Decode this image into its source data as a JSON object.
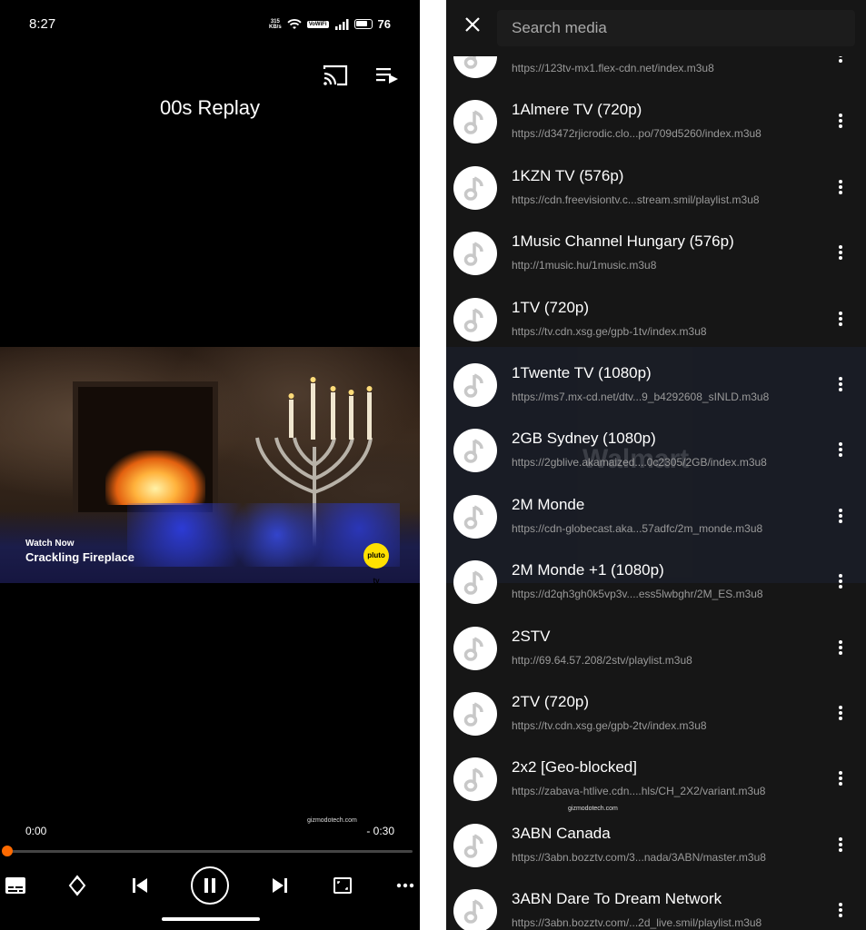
{
  "status_bar": {
    "time": "8:27",
    "net_speed_top": "315",
    "net_speed_bottom": "KB/s",
    "volte": "VoWiFi",
    "battery": "76"
  },
  "player": {
    "title": "00s Replay",
    "video_overlay": {
      "watch_now": "Watch Now",
      "program": "Crackling Fireplace",
      "brand": "pluto tv"
    },
    "watermark": "gizmodotech.com",
    "time_elapsed": "0:00",
    "time_remaining": "- 0:30",
    "progress": 0.0,
    "accent_color": "#ff6a00"
  },
  "media_list": {
    "search_placeholder": "Search media",
    "watermark": "gizmodotech.com",
    "background_ghost_text": "Walmart",
    "items": [
      {
        "name": "",
        "url": "https://123tv-mx1.flex-cdn.net/index.m3u8"
      },
      {
        "name": "1Almere TV (720p)",
        "url": "https://d3472rjicrodic.clo...po/709d5260/index.m3u8"
      },
      {
        "name": "1KZN TV (576p)",
        "url": "https://cdn.freevisiontv.c...stream.smil/playlist.m3u8"
      },
      {
        "name": "1Music Channel Hungary (576p)",
        "url": "http://1music.hu/1music.m3u8"
      },
      {
        "name": "1TV (720p)",
        "url": "https://tv.cdn.xsg.ge/gpb-1tv/index.m3u8"
      },
      {
        "name": "1Twente TV (1080p)",
        "url": "https://ms7.mx-cd.net/dtv...9_b4292608_sINLD.m3u8"
      },
      {
        "name": "2GB Sydney (1080p)",
        "url": "https://2gblive.akamaized....0c2305/2GB/index.m3u8"
      },
      {
        "name": "2M Monde",
        "url": "https://cdn-globecast.aka...57adfc/2m_monde.m3u8"
      },
      {
        "name": "2M Monde +1 (1080p)",
        "url": "https://d2qh3gh0k5vp3v....ess5lwbghr/2M_ES.m3u8"
      },
      {
        "name": "2STV",
        "url": "http://69.64.57.208/2stv/playlist.m3u8"
      },
      {
        "name": "2TV (720p)",
        "url": "https://tv.cdn.xsg.ge/gpb-2tv/index.m3u8"
      },
      {
        "name": "2x2 [Geo-blocked]",
        "url": "https://zabava-htlive.cdn....hls/CH_2X2/variant.m3u8"
      },
      {
        "name": "3ABN Canada",
        "url": "https://3abn.bozztv.com/3...nada/3ABN/master.m3u8"
      },
      {
        "name": "3ABN Dare To Dream Network",
        "url": "https://3abn.bozztv.com/...2d_live.smil/playlist.m3u8"
      }
    ]
  }
}
